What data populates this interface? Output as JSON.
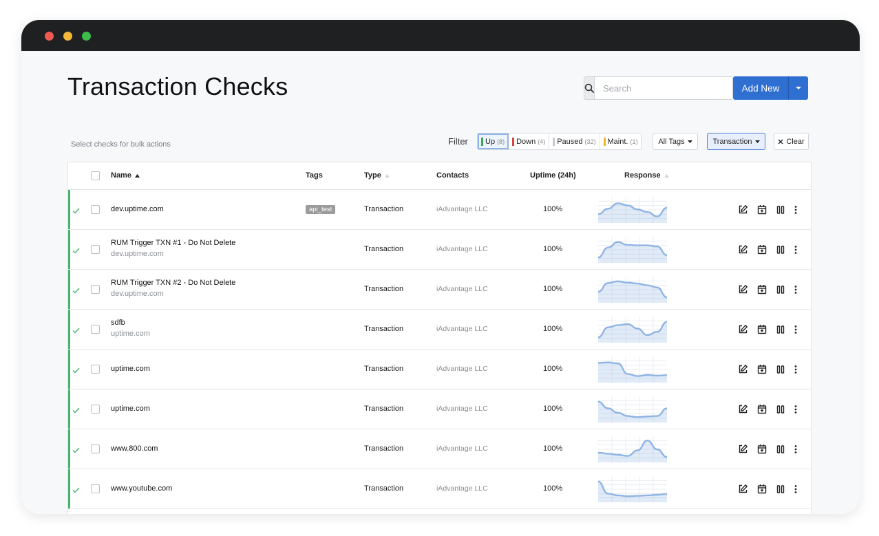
{
  "page": {
    "title": "Transaction Checks"
  },
  "search": {
    "placeholder": "Search"
  },
  "add_button": {
    "label": "Add New"
  },
  "bulk_hint": "Select checks for bulk actions",
  "filter": {
    "label": "Filter",
    "options": [
      {
        "label": "Up",
        "count": "(8)",
        "color": "#3aa655",
        "active": true
      },
      {
        "label": "Down",
        "count": "(4)",
        "color": "#e0433c",
        "active": false
      },
      {
        "label": "Paused",
        "count": "(32)",
        "color": "#c5c9ce",
        "active": false
      },
      {
        "label": "Maint.",
        "count": "(1)",
        "color": "#f1b52b",
        "active": false
      }
    ]
  },
  "tags_dropdown": {
    "label": "All Tags"
  },
  "type_dropdown": {
    "label": "Transaction"
  },
  "clear_button": {
    "label": "Clear"
  },
  "table": {
    "columns": {
      "name": "Name",
      "tags": "Tags",
      "type": "Type",
      "contacts": "Contacts",
      "uptime": "Uptime (24h)",
      "response": "Response"
    },
    "rows": [
      {
        "name": "dev.uptime.com",
        "sub": "",
        "tag": "api_test",
        "type": "Transaction",
        "contact": "iAdvantage LLC",
        "uptime": "100%",
        "response": [
          30,
          55,
          80,
          70,
          52,
          40,
          20,
          60
        ]
      },
      {
        "name": "RUM Trigger TXN #1 - Do Not Delete",
        "sub": "dev.uptime.com",
        "tag": "",
        "type": "Transaction",
        "contact": "iAdvantage LLC",
        "uptime": "100%",
        "response": [
          15,
          60,
          85,
          72,
          70,
          70,
          65,
          25
        ]
      },
      {
        "name": "RUM Trigger TXN #2 - Do Not Delete",
        "sub": "dev.uptime.com",
        "tag": "",
        "type": "Transaction",
        "contact": "iAdvantage LLC",
        "uptime": "100%",
        "response": [
          40,
          80,
          88,
          82,
          78,
          70,
          60,
          15
        ]
      },
      {
        "name": "sdfb",
        "sub": "uptime.com",
        "tag": "",
        "type": "Transaction",
        "contact": "iAdvantage LLC",
        "uptime": "100%",
        "response": [
          15,
          60,
          70,
          75,
          55,
          25,
          40,
          85
        ]
      },
      {
        "name": "uptime.com",
        "sub": "",
        "tag": "",
        "type": "Transaction",
        "contact": "iAdvantage LLC",
        "uptime": "100%",
        "response": [
          80,
          82,
          78,
          30,
          20,
          25,
          22,
          24
        ]
      },
      {
        "name": "uptime.com",
        "sub": "",
        "tag": "",
        "type": "Transaction",
        "contact": "iAdvantage LLC",
        "uptime": "100%",
        "response": [
          85,
          55,
          35,
          20,
          15,
          18,
          20,
          55
        ]
      },
      {
        "name": "www.800.com",
        "sub": "",
        "tag": "",
        "type": "Transaction",
        "contact": "iAdvantage LLC",
        "uptime": "100%",
        "response": [
          35,
          30,
          25,
          20,
          45,
          90,
          50,
          15
        ]
      },
      {
        "name": "www.youtube.com",
        "sub": "",
        "tag": "",
        "type": "Transaction",
        "contact": "iAdvantage LLC",
        "uptime": "100%",
        "response": [
          85,
          30,
          22,
          18,
          20,
          22,
          25,
          28
        ]
      }
    ]
  }
}
